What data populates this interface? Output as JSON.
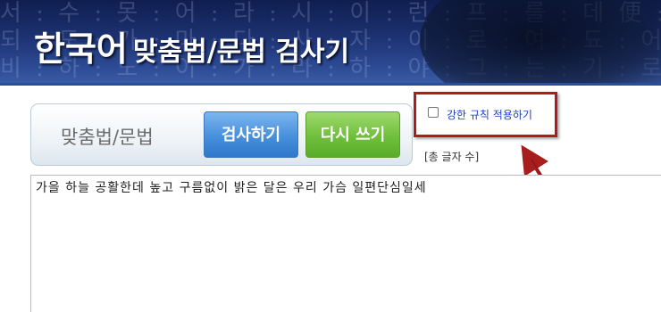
{
  "header": {
    "title_main": "한국어",
    "title_sub": "맞춤법/문법 검사기",
    "background_text": [
      "서 : 수 : 못 : 어 : 라 : 시 : 이 : 런 : 프 : 를 : 데 便 : 사 : 새 : 내 : 를 : 한",
      "되 : 도 : 가 : 마 : 다 : 사 : 자 : 이 : 로 : 여 : 됴 : 어 : 니 : 하 : 노 : 니 : 앗",
      "비 : 하 : 노 : 이 : 가 : 라 : 하 : 야 : 그 : 는 : 기 : 로 : 브 : 로 : 이 : 러 : 니"
    ]
  },
  "toolbar": {
    "label": "맞춤법/문법",
    "check_button": "검사하기",
    "reset_button": "다시 쓰기"
  },
  "options": {
    "strict_rules_label": "강한 규칙 적용하기",
    "strict_rules_checked": false
  },
  "counter": {
    "label": "[총 글자 수]"
  },
  "editor": {
    "text": "가을 하늘 공활한데 높고 구름없이 밝은 달은 우리 가슴 일편단심일세"
  },
  "colors": {
    "banner": "#1d3272",
    "highlight_box": "#b01c1c",
    "check_button": "#4690dc",
    "reset_button": "#6fbf3b",
    "option_label": "#1a3fc2"
  }
}
